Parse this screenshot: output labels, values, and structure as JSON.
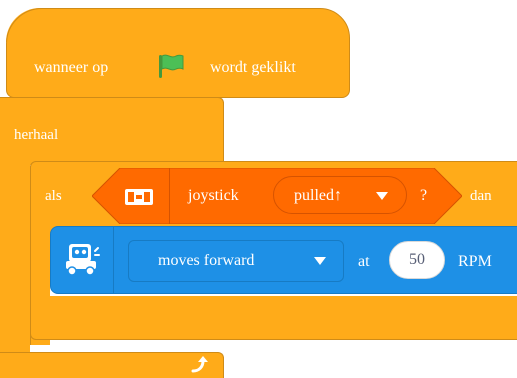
{
  "hat_block": {
    "prefix": "wanneer op",
    "icon": "green-flag-icon",
    "suffix": "wordt geklikt"
  },
  "repeat_block": {
    "label": "herhaal",
    "icon": "loop-arrow-icon"
  },
  "if_block": {
    "label": "als",
    "then_label": "dan",
    "condition": {
      "sensor_icon": "joystick-sensor-icon",
      "sensor_label": "joystick",
      "state_value": "pulled↑",
      "suffix": "?"
    }
  },
  "motion_block": {
    "icon": "robot-icon",
    "direction_value": "moves forward",
    "at_label": "at",
    "speed_value": "50",
    "unit_label": "RPM"
  },
  "colors": {
    "control": "#FFAB19",
    "sensor": "#FF6A00",
    "motion": "#1E90E6",
    "flag": "#4CBF56"
  }
}
